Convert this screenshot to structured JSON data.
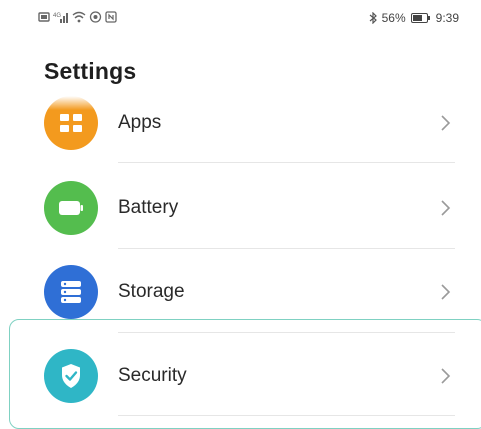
{
  "status_bar": {
    "battery_percent": "56%",
    "time": "9:39",
    "left_icons": [
      "sim-icon",
      "signal-icon",
      "wifi-icon",
      "eye-icon",
      "nfc-icon"
    ],
    "right_icons": [
      "bluetooth-icon",
      "battery-icon"
    ]
  },
  "page": {
    "title": "Settings"
  },
  "items": [
    {
      "label": "Apps",
      "icon": "apps-icon",
      "color": "#f39a1e"
    },
    {
      "label": "Battery",
      "icon": "battery-icon",
      "color": "#54bd4e"
    },
    {
      "label": "Storage",
      "icon": "storage-icon",
      "color": "#2f6fd6"
    },
    {
      "label": "Security",
      "icon": "shield-icon",
      "color": "#2fb6c6"
    }
  ],
  "colors": {
    "highlight_border": "#7fd1c2",
    "divider": "#e6e6e6"
  }
}
